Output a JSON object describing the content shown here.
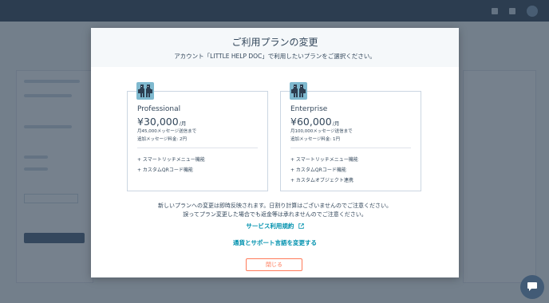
{
  "modal": {
    "title": "ご利用プランの変更",
    "subtitle": "アカウント「LITTLE HELP DOC」で利用したいプランをご選択ください。",
    "plans": [
      {
        "name": "Professional",
        "price": "¥30,000",
        "per": "/月",
        "line1": "月45,000メッセージ送信まで",
        "line2": "追加メッセージ料金: 2円",
        "features": [
          "+ スマートリッチメニュー機能",
          "+ カスタムQRコード機能"
        ]
      },
      {
        "name": "Enterprise",
        "price": "¥60,000",
        "per": "/月",
        "line1": "月100,000メッセージ送信まで",
        "line2": "追加メッセージ料金: 1円",
        "features": [
          "+ スマートリッチメニュー機能",
          "+ カスタムQRコード機能",
          "+ カスタムオブジェクト連携"
        ]
      }
    ],
    "notice_line1": "新しいプランへの変更は即時反映されます。日割り計算はございませんのでご注意ください。",
    "notice_line2": "誤ってプラン変更した場合でも返金等は承れませんのでご注意ください。",
    "terms_link": "サービス利用規約",
    "currency_link": "通貨とサポート言語を変更する",
    "close_button": "閉じる"
  },
  "colors": {
    "accent": "#0091ae",
    "close": "#ff7a59",
    "nav": "#2d3e50"
  },
  "icons": {
    "plan_icon": "robot-icon",
    "external": "external-link-icon",
    "chat": "chat-bubble-icon"
  }
}
